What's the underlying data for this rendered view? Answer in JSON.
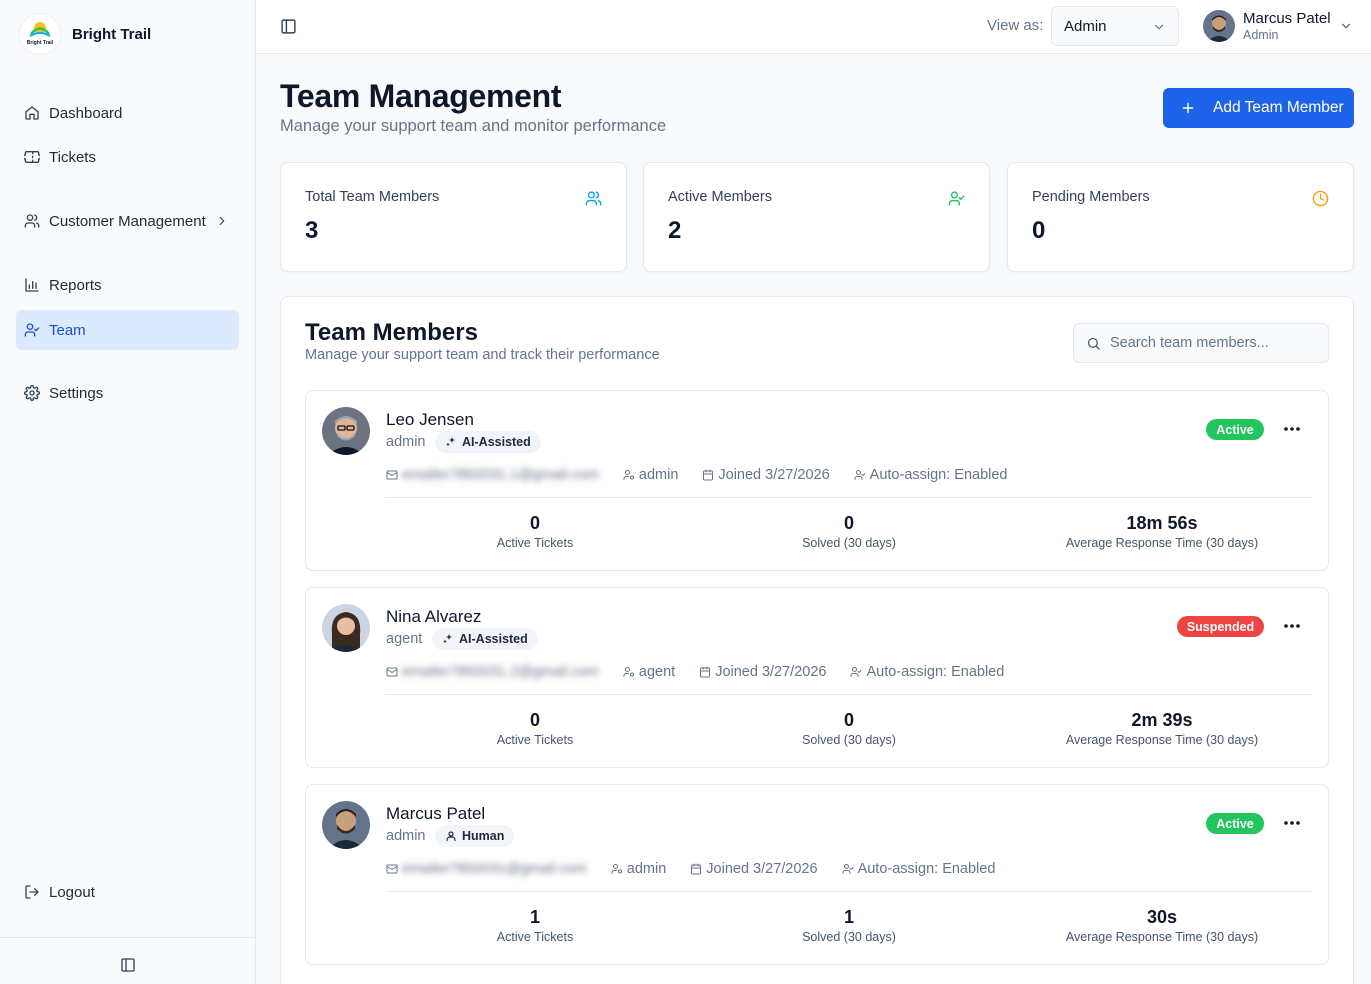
{
  "brand": {
    "name": "Bright Trail",
    "logo_text": "Bright Trail"
  },
  "sidebar": {
    "items": [
      {
        "label": "Dashboard",
        "icon": "home-icon"
      },
      {
        "label": "Tickets",
        "icon": "ticket-icon"
      },
      {
        "label": "Customer Management",
        "icon": "users-icon"
      },
      {
        "label": "Reports",
        "icon": "bar-chart-icon"
      },
      {
        "label": "Team",
        "icon": "user-check-icon",
        "active": true
      },
      {
        "label": "Settings",
        "icon": "gear-icon"
      }
    ],
    "logout_label": "Logout"
  },
  "header": {
    "view_as_label": "View as:",
    "view_as_value": "Admin",
    "user_name": "Marcus Patel",
    "user_role": "Admin"
  },
  "page": {
    "title": "Team Management",
    "subtitle": "Manage your support team and monitor performance",
    "add_button_label": "Add Team Member"
  },
  "stats": [
    {
      "label": "Total Team Members",
      "value": "3",
      "icon": "users-icon",
      "color": "#0ea5e9"
    },
    {
      "label": "Active Members",
      "value": "2",
      "icon": "user-check-icon",
      "color": "#22c55e"
    },
    {
      "label": "Pending Members",
      "value": "0",
      "icon": "clock-icon",
      "color": "#f59e0b"
    }
  ],
  "team": {
    "title": "Team Members",
    "subtitle": "Manage your support team and track their performance",
    "search_placeholder": "Search team members...",
    "members": [
      {
        "name": "Leo Jensen",
        "role": "admin",
        "type": "AI-Assisted",
        "status": "Active",
        "status_color": "#22c55e",
        "email": "emailer7892031.1@gmail.com",
        "meta_role": "admin",
        "joined": "Joined 3/27/2026",
        "auto_assign": "Auto-assign: Enabled",
        "active_tickets": "0",
        "solved": "0",
        "avg_response": "18m 56s"
      },
      {
        "name": "Nina Alvarez",
        "role": "agent",
        "type": "AI-Assisted",
        "status": "Suspended",
        "status_color": "#ef4444",
        "email": "emailer7892031.2@gmail.com",
        "meta_role": "agent",
        "joined": "Joined 3/27/2026",
        "auto_assign": "Auto-assign: Enabled",
        "active_tickets": "0",
        "solved": "0",
        "avg_response": "2m 39s"
      },
      {
        "name": "Marcus Patel",
        "role": "admin",
        "type": "Human",
        "status": "Active",
        "status_color": "#22c55e",
        "email": "emailer7892031@gmail.com",
        "meta_role": "admin",
        "joined": "Joined 3/27/2026",
        "auto_assign": "Auto-assign: Enabled",
        "active_tickets": "1",
        "solved": "1",
        "avg_response": "30s"
      }
    ],
    "stat_labels": {
      "active_tickets": "Active Tickets",
      "solved": "Solved (30 days)",
      "avg_response": "Average Response Time (30 days)"
    }
  }
}
